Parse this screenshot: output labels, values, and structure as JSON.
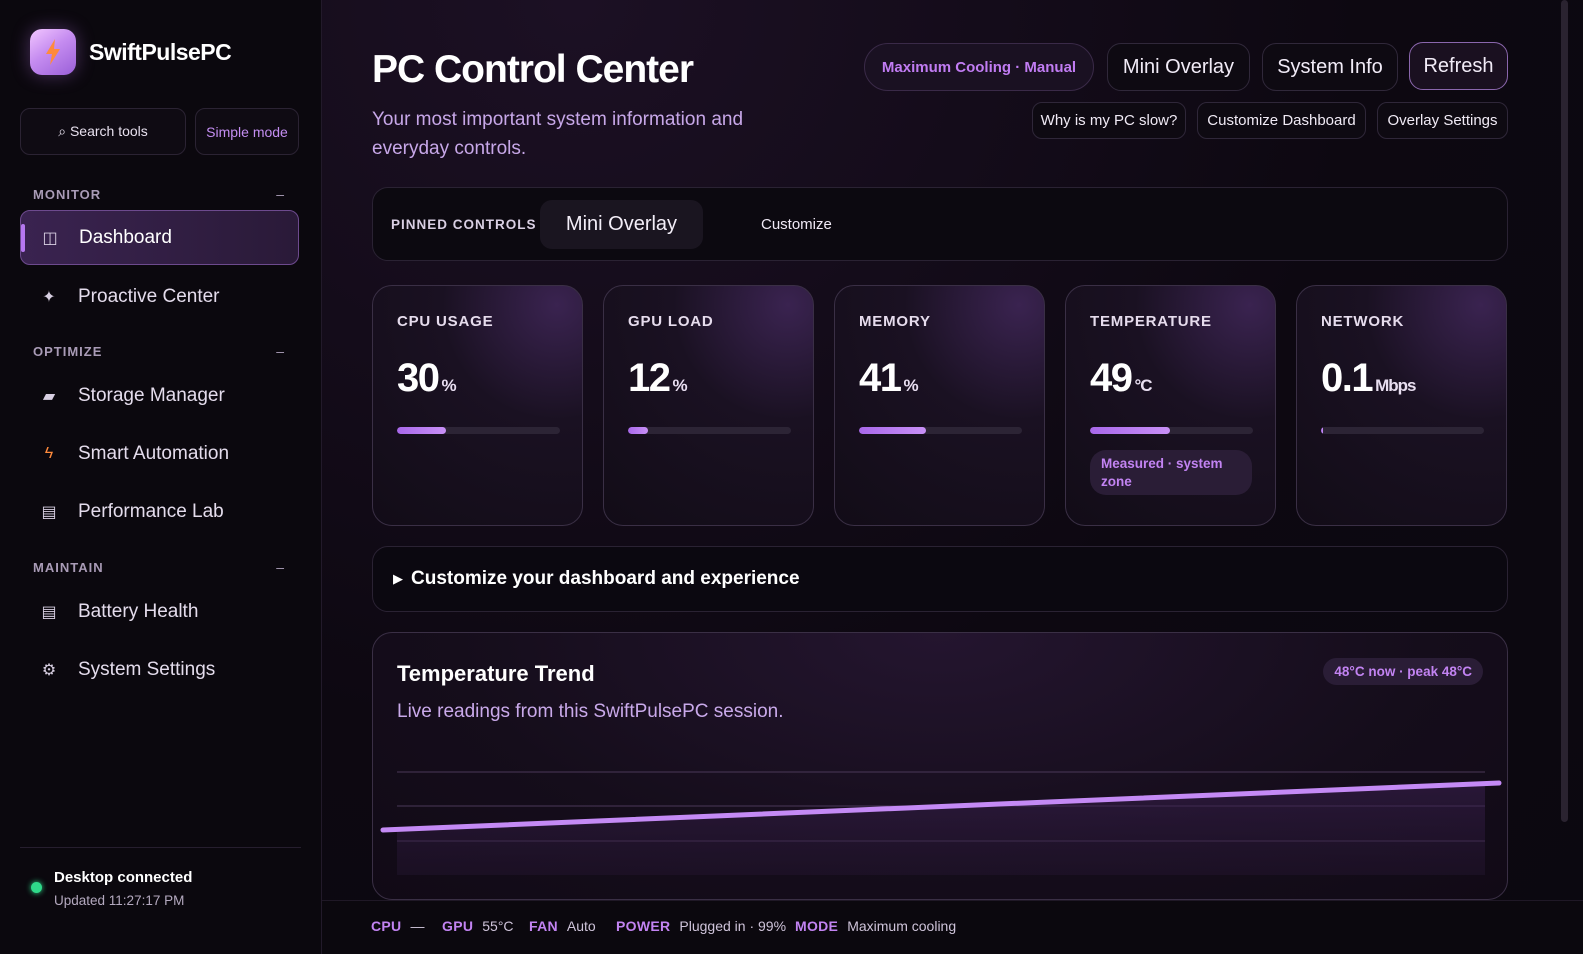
{
  "app": {
    "name": "SwiftPulsePC",
    "accent": "#b678f0"
  },
  "sidebar": {
    "search_label": "⌕ Search tools",
    "simple_mode_label": "Simple mode",
    "sections": [
      {
        "title": "MONITOR",
        "toggle": "–"
      },
      {
        "title": "OPTIMIZE",
        "toggle": "–"
      },
      {
        "title": "MAINTAIN",
        "toggle": "–"
      }
    ],
    "items": [
      {
        "label": "Dashboard",
        "icon": "dashboard-icon",
        "glyph": "◫"
      },
      {
        "label": "Proactive Center",
        "icon": "sparkle-icon",
        "glyph": "✦"
      },
      {
        "label": "Storage Manager",
        "icon": "drive-icon",
        "glyph": "▰"
      },
      {
        "label": "Smart Automation",
        "icon": "bolt-icon",
        "glyph": "ϟ"
      },
      {
        "label": "Performance Lab",
        "icon": "list-icon",
        "glyph": "▤"
      },
      {
        "label": "Battery Health",
        "icon": "list-icon",
        "glyph": "▤"
      },
      {
        "label": "System Settings",
        "icon": "gear-icon",
        "glyph": "⚙"
      }
    ],
    "connection": {
      "title": "Desktop connected",
      "updated": "Updated 11:27:17 PM",
      "status_color": "#2fd98a"
    }
  },
  "header": {
    "title": "PC Control Center",
    "subtitle": "Your most important system information and everyday controls.",
    "mode_pill": "Maximum Cooling · Manual",
    "buttons": {
      "mini_overlay": "Mini Overlay",
      "system_info": "System Info",
      "refresh": "Refresh"
    },
    "small_buttons": {
      "why_slow": "Why is my PC slow?",
      "customize_dashboard": "Customize Dashboard",
      "overlay_settings": "Overlay Settings"
    }
  },
  "pinned": {
    "label": "PINNED CONTROLS",
    "chip": "Mini Overlay",
    "customize": "Customize"
  },
  "metrics": [
    {
      "label": "CPU USAGE",
      "value": "30",
      "unit": "%",
      "fill": 0.3
    },
    {
      "label": "GPU LOAD",
      "value": "12",
      "unit": "%",
      "fill": 0.12
    },
    {
      "label": "MEMORY",
      "value": "41",
      "unit": "%",
      "fill": 0.41
    },
    {
      "label": "TEMPERATURE",
      "value": "49",
      "unit": "°C",
      "fill": 0.49,
      "note": "Measured · system zone"
    },
    {
      "label": "NETWORK",
      "value": "0.1",
      "unit": "Mbps",
      "fill": 0.01
    }
  ],
  "customize_section": {
    "label": "Customize your dashboard and experience"
  },
  "trend": {
    "title": "Temperature Trend",
    "subtitle": "Live readings from this SwiftPulsePC session.",
    "badge": "48°C now · peak 48°C"
  },
  "statusbar": {
    "cpu": {
      "key": "CPU",
      "value": "—"
    },
    "gpu": {
      "key": "GPU",
      "value": "55°C"
    },
    "fan": {
      "key": "FAN",
      "value": "Auto"
    },
    "power": {
      "key": "POWER",
      "value": "Plugged in · 99%"
    },
    "mode": {
      "key": "MODE",
      "value": "Maximum cooling"
    }
  }
}
